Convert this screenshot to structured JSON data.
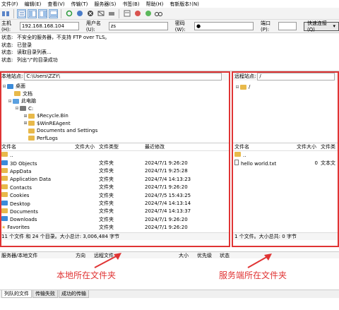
{
  "menu": [
    "文件(F)",
    "编辑(E)",
    "查看(V)",
    "传输(T)",
    "服务器(S)",
    "书签(B)",
    "帮助(H)",
    "有新版本!(N)"
  ],
  "toolbar_icons": [
    "site-manager-icon",
    "toggle-log-icon",
    "toggle-local-tree-icon",
    "toggle-remote-tree-icon",
    "toggle-queue-icon",
    "refresh-icon",
    "process-queue-icon",
    "cancel-icon",
    "disconnect-icon",
    "reconnect-icon",
    "filter-icon",
    "compare-icon",
    "sync-browse-icon",
    "search-icon"
  ],
  "quickconnect": {
    "host_label": "主机(H):",
    "host_value": "192.168.168.104",
    "user_label": "用户名(U):",
    "user_value": "zs",
    "pass_label": "密码(W):",
    "pass_value": "●",
    "port_label": "端口(P):",
    "port_value": "",
    "button": "快速连接(Q)",
    "arrow": "▾"
  },
  "log": [
    {
      "k": "状态:",
      "v": "不安全的服务器，不支持 FTP over TLS。"
    },
    {
      "k": "状态:",
      "v": "已登录"
    },
    {
      "k": "状态:",
      "v": "读取目录列表..."
    },
    {
      "k": "状态:",
      "v": "列出\"/\"的目录成功"
    }
  ],
  "local": {
    "path_label": "本地站点:",
    "path_value": "C:\\Users\\ZZY\\",
    "tree": [
      "桌面",
      "文档",
      "此电脑",
      "C:",
      "$Recycle.Bin",
      "$WinREAgent",
      "Documents and Settings",
      "PerfLogs"
    ],
    "headers": [
      "文件名",
      "文件大小",
      "文件类型",
      "最近修改"
    ],
    "files": [
      {
        "name": "..",
        "size": "",
        "type": "",
        "date": ""
      },
      {
        "name": "3D Objects",
        "size": "",
        "type": "文件夹",
        "date": "2024/7/1 9:26:20"
      },
      {
        "name": "AppData",
        "size": "",
        "type": "文件夹",
        "date": "2024/7/1 9:25:28"
      },
      {
        "name": "Application Data",
        "size": "",
        "type": "文件夹",
        "date": "2024/7/4 14:13:23"
      },
      {
        "name": "Contacts",
        "size": "",
        "type": "文件夹",
        "date": "2024/7/1 9:26:20"
      },
      {
        "name": "Cookies",
        "size": "",
        "type": "文件夹",
        "date": "2024/7/5 15:43:25"
      },
      {
        "name": "Desktop",
        "size": "",
        "type": "文件夹",
        "date": "2024/7/4 14:13:14"
      },
      {
        "name": "Documents",
        "size": "",
        "type": "文件夹",
        "date": "2024/7/4 14:13:37"
      },
      {
        "name": "Downloads",
        "size": "",
        "type": "文件夹",
        "date": "2024/7/1 9:26:20"
      },
      {
        "name": "Favorites",
        "size": "",
        "type": "文件夹",
        "date": "2024/7/1 9:26:20"
      }
    ],
    "status": "11 个文件 和 24 个目录。大小总计: 3,006,484 字节"
  },
  "remote": {
    "path_label": "远程站点:",
    "path_value": "/",
    "tree": [
      "/"
    ],
    "headers": [
      "文件名",
      "文件大小",
      "文件类"
    ],
    "files": [
      {
        "name": "..",
        "size": "",
        "type": ""
      },
      {
        "name": "hello world.txt",
        "size": "0",
        "type": "文本文"
      }
    ],
    "status": "1 个文件。大小总共: 0 字节"
  },
  "queue_headers": [
    "服务器/本地文件",
    "方向",
    "远程文件",
    "大小",
    "优先级",
    "状态"
  ],
  "tabs": [
    "列队的文件",
    "传输失败",
    "成功的传输"
  ],
  "annotations": {
    "local": "本地所在文件夹",
    "remote": "服务端所在文件夹"
  },
  "accent_red": "#e03434"
}
